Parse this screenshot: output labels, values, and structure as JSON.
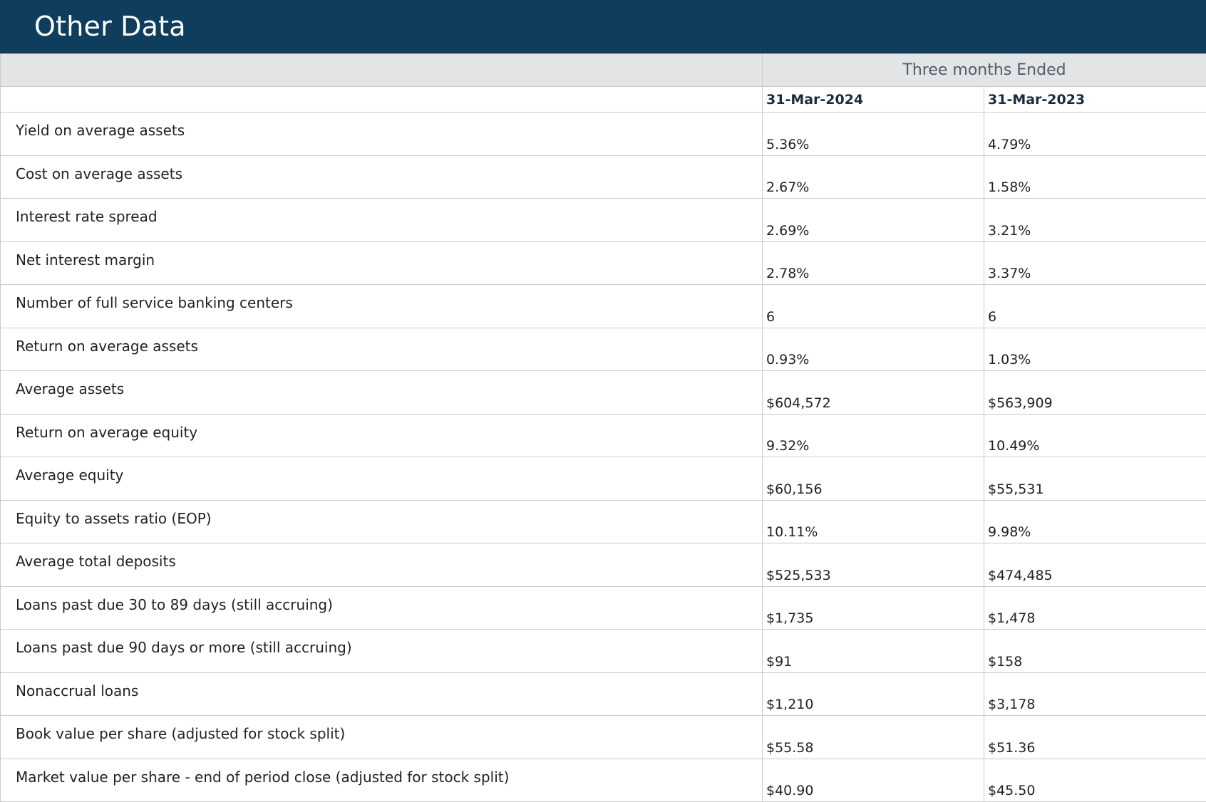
{
  "title": "Other Data",
  "header": {
    "group_label": "Three months Ended",
    "columns": [
      "31-Mar-2024",
      "31-Mar-2023"
    ]
  },
  "rows": [
    {
      "label": "Yield on average assets",
      "v2024": "5.36%",
      "v2023": "4.79%"
    },
    {
      "label": "Cost on average assets",
      "v2024": "2.67%",
      "v2023": "1.58%"
    },
    {
      "label": "Interest rate spread",
      "v2024": "2.69%",
      "v2023": "3.21%"
    },
    {
      "label": "Net interest margin",
      "v2024": "2.78%",
      "v2023": "3.37%"
    },
    {
      "label": "Number of full service banking centers",
      "v2024": "6",
      "v2023": "6"
    },
    {
      "label": "Return on average assets",
      "v2024": "0.93%",
      "v2023": "1.03%"
    },
    {
      "label": "Average assets",
      "v2024": "$604,572",
      "v2023": "$563,909"
    },
    {
      "label": "Return on average equity",
      "v2024": "9.32%",
      "v2023": "10.49%"
    },
    {
      "label": "Average equity",
      "v2024": "$60,156",
      "v2023": "$55,531"
    },
    {
      "label": "Equity to assets ratio (EOP)",
      "v2024": "10.11%",
      "v2023": "9.98%"
    },
    {
      "label": "Average total deposits",
      "v2024": "$525,533",
      "v2023": "$474,485"
    },
    {
      "label": "Loans past due 30 to 89 days (still accruing)",
      "v2024": "$1,735",
      "v2023": "$1,478"
    },
    {
      "label": "Loans past due 90 days or more (still accruing)",
      "v2024": "$91",
      "v2023": "$158"
    },
    {
      "label": "Nonaccrual loans",
      "v2024": "$1,210",
      "v2023": "$3,178"
    },
    {
      "label": "Book value per share (adjusted for stock split)",
      "v2024": "$55.58",
      "v2023": "$51.36"
    },
    {
      "label": "Market value per share - end of period close (adjusted for stock split)",
      "v2024": "$40.90",
      "v2023": "$45.50"
    }
  ],
  "colors": {
    "title_bar": "#0e3d5e",
    "title_text": "#ffffff",
    "group_header_bg": "#e3e4e5",
    "group_header_text": "#4b5e70",
    "grid_lines": "#c8cacc"
  }
}
